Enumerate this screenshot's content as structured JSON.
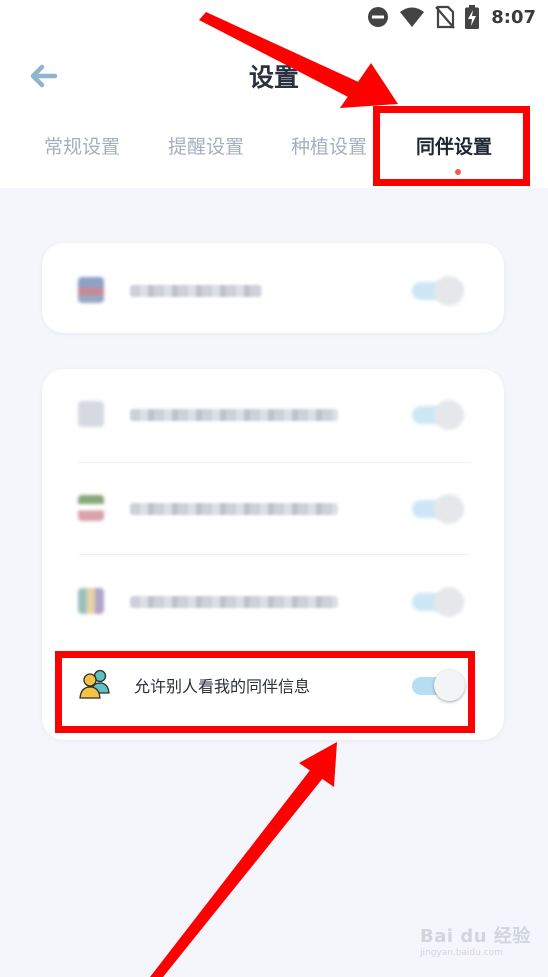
{
  "status_bar": {
    "time": "8:07",
    "icons": [
      "do-not-disturb-icon",
      "wifi-icon",
      "no-sim-icon",
      "battery-charging-icon"
    ]
  },
  "header": {
    "title": "设置",
    "back_icon": "arrow-left-icon"
  },
  "tabs": [
    {
      "label": "常规设置",
      "active": false
    },
    {
      "label": "提醒设置",
      "active": false
    },
    {
      "label": "种植设置",
      "active": false
    },
    {
      "label": "同伴设置",
      "active": true
    }
  ],
  "colors": {
    "accent_dot": "#f15a55",
    "toggle_track": "#b8ddf3",
    "annotation_red": "#ff0000",
    "background": "#f4f6fb"
  },
  "privacy_row": {
    "label": "允许别人看我的同伴信息",
    "icon": "people-icon",
    "toggle_on": false
  },
  "watermark": {
    "brand": "Bai du 经验",
    "url": "jingyan.baidu.com"
  }
}
